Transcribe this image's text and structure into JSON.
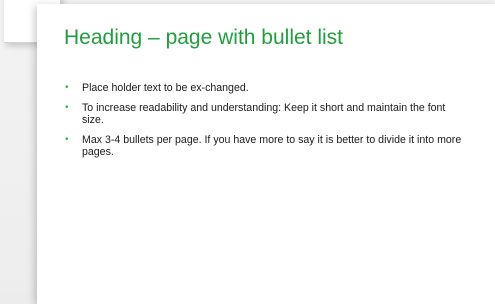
{
  "slide": {
    "title": "Heading – page with bullet list",
    "bullets": [
      "Place holder text to be ex-changed.",
      "To increase readability and understanding: Keep it short and maintain the font size.",
      "Max 3-4 bullets per page. If you have more to say it is better to divide it into more pages."
    ]
  },
  "colors": {
    "title": "#1f9f3c",
    "bullet_mark": "#39b54a",
    "body_text": "#1a1a1a"
  }
}
